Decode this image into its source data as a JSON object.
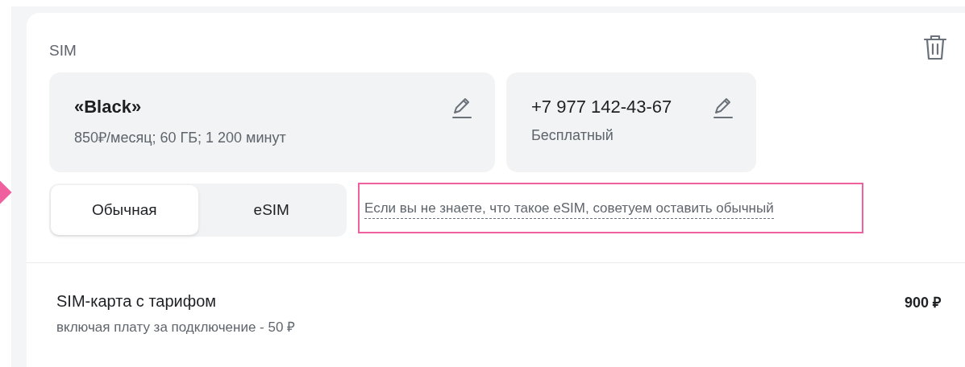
{
  "section_title": "SIM",
  "tariff_cards": [
    {
      "title": "«Black»",
      "subtitle": "850₽/месяц; 60 ГБ; 1 200 минут",
      "bold": true
    },
    {
      "title": "+7 977 142-43-67",
      "subtitle": "Бесплатный",
      "bold": false
    }
  ],
  "sim_type_tabs": [
    {
      "label": "Обычная",
      "selected": true
    },
    {
      "label": "eSIM",
      "selected": false
    }
  ],
  "hint": {
    "text": "Если вы не знаете, что такое eSIM, советуем оставить обычный",
    "highlighted": true
  },
  "summary": {
    "title": "SIM-карта с тарифом",
    "note": "включая плату за подключение - 50 ₽",
    "price": "900 ₽"
  }
}
